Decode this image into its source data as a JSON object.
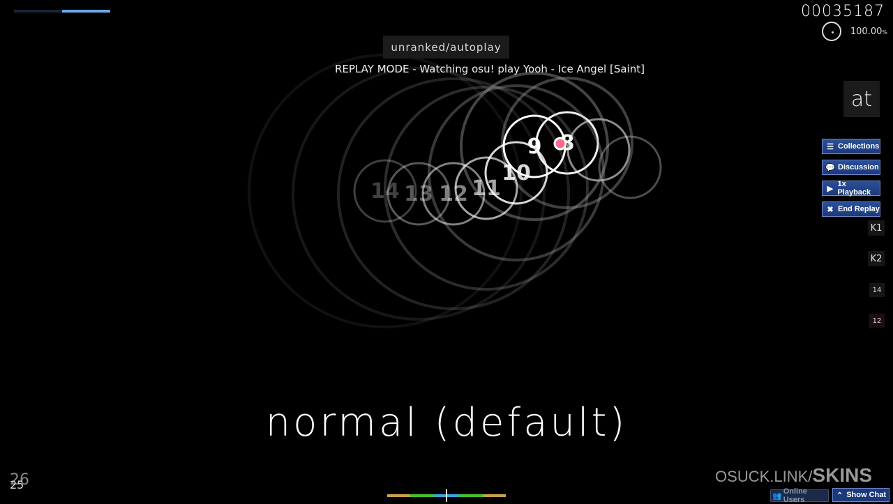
{
  "hud": {
    "score": "00035187",
    "accuracy": "100.00",
    "accuracy_unit": "%",
    "health_fraction": 0.5,
    "combo_prev": "26",
    "combo": "25"
  },
  "mods_label": "unranked/autoplay",
  "replay_text": "REPLAY MODE - Watching osu! play Yooh - Ice Angel [Saint]",
  "spectator_box": "at",
  "buttons": [
    {
      "label": "Collections",
      "icon": "list-icon"
    },
    {
      "label": "Discussion",
      "icon": "chat-bubbles-icon"
    },
    {
      "label": "1x Playback",
      "icon": "play-icon"
    },
    {
      "label": "End Replay",
      "icon": "close-icon"
    }
  ],
  "keys": [
    {
      "label": "K1"
    },
    {
      "label": "K2"
    },
    {
      "label": "14"
    },
    {
      "label": "12"
    }
  ],
  "hit_objects": [
    "14",
    "13",
    "12",
    "11",
    "10",
    "9",
    "8",
    "",
    ""
  ],
  "skin_name": "normal (default)",
  "watermark": {
    "domain": "OSUCK.LINK/",
    "word": "SKINS"
  },
  "online_users_label": "Online Users",
  "show_chat_label": "Show Chat",
  "colors": {
    "button": "#1c3a7a",
    "health": "#6aa8ec",
    "cursor": "#ff6a8a"
  }
}
